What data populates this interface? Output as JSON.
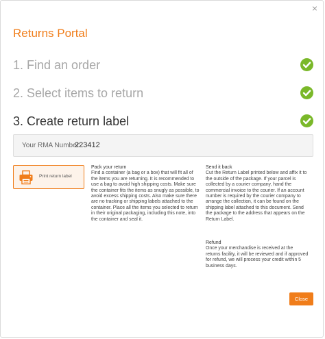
{
  "modal": {
    "close_glyph": "×",
    "title": "Returns Portal"
  },
  "steps": [
    {
      "label": "1. Find an order",
      "status": "complete"
    },
    {
      "label": "2. Select items to return",
      "status": "complete"
    },
    {
      "label": "3. Create return label",
      "status": "complete",
      "active": true
    }
  ],
  "rma": {
    "label": "Your RMA Number:",
    "value": "223412"
  },
  "print_button": {
    "label": "Print return label",
    "icon": "printer-icon"
  },
  "pack": {
    "heading": "Pack your return",
    "text": "Find a container (a bag or a box) that will fit all of the items you are returning. It is recommended to use a bag to avoid high shipping costs. Make sure the container fits the items as snugly as possible, to avoid excess shipping costs. Also make sure there are no tracking or shipping labels attached to the container. Place all the items you selected to return in their original packaging, including this note, into the container and seal it."
  },
  "send": {
    "heading": "Send it back",
    "text": "Cut the Return Label printed below and affix it to the outside of the package. If your parcel is collected by a courier company, hand the commercial invoice to the courier. If an account number is required by the courier company to arrange the collection, it can be found on the shipping label attached to this document. Send the package to the address that appears on the Return Label."
  },
  "refund": {
    "heading": "Refund",
    "text": "Once your merchandise is received at the returns facility, it will be reviewed and if approved for refund, we will process your credit within 5 business days."
  },
  "footer": {
    "close_label": "Close"
  },
  "colors": {
    "accent": "#f07d1a",
    "check": "#7ab829"
  }
}
